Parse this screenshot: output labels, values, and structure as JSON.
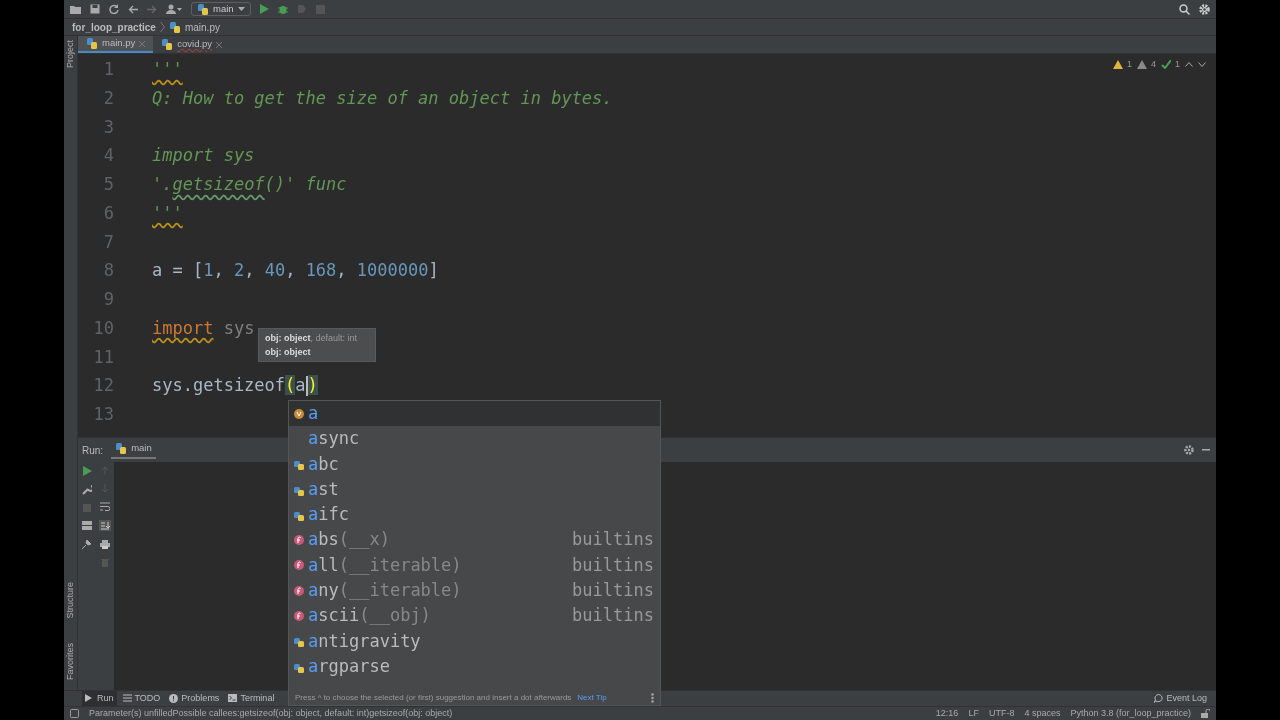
{
  "toolbar": {
    "run_config": "main"
  },
  "breadcrumb": {
    "project": "for_loop_practice",
    "file": "main.py"
  },
  "side_stripe": {
    "top": [
      "Project"
    ],
    "bottom": [
      "Structure",
      "Favorites"
    ]
  },
  "tabs": [
    {
      "label": "main.py",
      "selected": true,
      "has_errors": false
    },
    {
      "label": "covid.py",
      "selected": false,
      "has_errors": true
    }
  ],
  "inspections": [
    {
      "kind": "warning",
      "count": "1"
    },
    {
      "kind": "weak_warning",
      "count": "4"
    },
    {
      "kind": "typo",
      "count": "1"
    }
  ],
  "editor": {
    "lines": [
      {
        "number": "1",
        "tokens": [
          {
            "text": "'''",
            "kind": "docstring_warning"
          }
        ]
      },
      {
        "number": "2",
        "tokens": [
          {
            "text": "Q: How to get the size of an object in bytes.",
            "kind": "docstring"
          }
        ]
      },
      {
        "number": "3"
      },
      {
        "number": "4",
        "tokens": [
          {
            "text": "import sys",
            "kind": "docstring"
          }
        ]
      },
      {
        "number": "5",
        "tokens": [
          {
            "text": "'.",
            "kind": "docstring"
          },
          {
            "text": "getsizeof",
            "kind": "docstring_typo"
          },
          {
            "text": "()' func",
            "kind": "docstring"
          }
        ]
      },
      {
        "number": "6",
        "tokens": [
          {
            "text": "'''",
            "kind": "docstring_warning"
          }
        ]
      },
      {
        "number": "7"
      },
      {
        "number": "8",
        "tokens": [
          {
            "text": "a = [",
            "kind": "plain"
          },
          {
            "text": "1",
            "kind": "number"
          },
          {
            "text": ", ",
            "kind": "plain"
          },
          {
            "text": "2",
            "kind": "number"
          },
          {
            "text": ", ",
            "kind": "plain"
          },
          {
            "text": "40",
            "kind": "number"
          },
          {
            "text": ", ",
            "kind": "plain"
          },
          {
            "text": "168",
            "kind": "number"
          },
          {
            "text": ", ",
            "kind": "plain"
          },
          {
            "text": "1000000",
            "kind": "number"
          },
          {
            "text": "]",
            "kind": "plain"
          }
        ]
      },
      {
        "number": "9"
      },
      {
        "number": "10",
        "tokens": [
          {
            "text": "import",
            "kind": "keyword_warning"
          },
          {
            "text": " sys",
            "kind": "unused"
          }
        ]
      },
      {
        "number": "11"
      },
      {
        "number": "12",
        "tokens": [
          {
            "text": "sys.getsizeof",
            "kind": "plain"
          },
          {
            "text": "(",
            "kind": "paren_match"
          },
          {
            "text": "a",
            "kind": "plain",
            "caret": true
          },
          {
            "text": ")",
            "kind": "paren_match"
          }
        ]
      },
      {
        "number": "13"
      }
    ]
  },
  "param_info": [
    {
      "name": "obj: object",
      "rest": ", default: int"
    },
    {
      "name": "obj: object"
    }
  ],
  "completion": {
    "items": [
      {
        "kind": "variable",
        "match": "a",
        "selected": true
      },
      {
        "kind": "keyword",
        "match": "a",
        "rest": "sync",
        "selected": false
      },
      {
        "kind": "module",
        "match": "a",
        "rest": "bc",
        "selected": false
      },
      {
        "kind": "module",
        "match": "a",
        "rest": "st",
        "selected": false
      },
      {
        "kind": "module",
        "match": "a",
        "rest": "ifc",
        "selected": false
      },
      {
        "kind": "function",
        "match": "a",
        "rest": "bs",
        "signature": "(__x)",
        "source": "builtins",
        "selected": false
      },
      {
        "kind": "function",
        "match": "a",
        "rest": "ll",
        "signature": "(__iterable)",
        "source": "builtins",
        "selected": false
      },
      {
        "kind": "function",
        "match": "a",
        "rest": "ny",
        "signature": "(__iterable)",
        "source": "builtins",
        "selected": false
      },
      {
        "kind": "function",
        "match": "a",
        "rest": "scii",
        "signature": "(__obj)",
        "source": "builtins",
        "selected": false
      },
      {
        "kind": "module",
        "match": "a",
        "rest": "ntigravity",
        "selected": false
      },
      {
        "kind": "module",
        "match": "a",
        "rest": "rgparse",
        "selected": false
      }
    ],
    "hint": "Press ^ to choose the selected (or first) suggestion and insert a dot afterwards",
    "next_tip": "Next Tip"
  },
  "run_panel": {
    "title": "Run:",
    "tab": "main"
  },
  "bottom_tabs": [
    {
      "label": "Run",
      "selected": true
    },
    {
      "label": "TODO",
      "selected": false
    },
    {
      "label": "Problems",
      "selected": false
    },
    {
      "label": "Terminal",
      "selected": false
    }
  ],
  "event_log": "Event Log",
  "status_bar": {
    "message": "Parameter(s) unfilledPossible callees:getsizeof(obj: object, default: int)getsizeof(obj: object)",
    "items": [
      "12:16",
      "LF",
      "UTF-8",
      "4 spaces",
      "Python 3.8 (for_loop_practice)"
    ]
  }
}
